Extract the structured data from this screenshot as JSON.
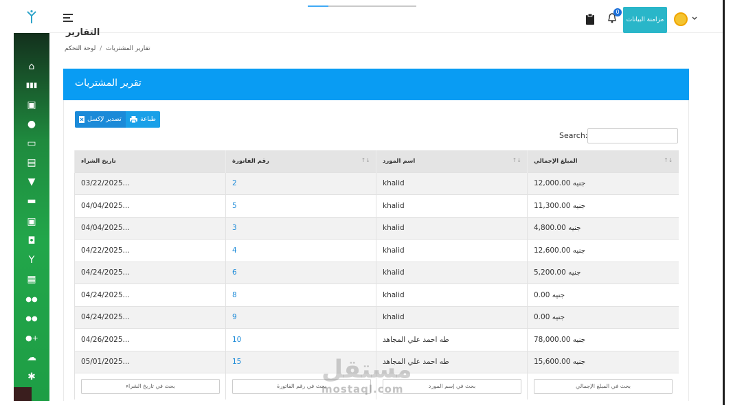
{
  "topbar": {
    "sync_button": "مزامنة البيانات",
    "notification_count": "0"
  },
  "page": {
    "title": "التقارير",
    "breadcrumb": [
      "تقارير المشتريات",
      "لوحة التحكم"
    ]
  },
  "card": {
    "title": "تقرير المشتريات",
    "export_label": "تصدير لإكسل",
    "print_label": "طباعة",
    "search_label": "Search:",
    "search_value": ""
  },
  "table": {
    "columns": [
      "تاريخ الشراء",
      "رقم الفاتورة",
      "اسم المورد",
      "المبلغ الإجمالي"
    ],
    "rows": [
      [
        "03/22/2025...",
        "2",
        "khalid",
        "12,000.00 جنيه"
      ],
      [
        "04/04/2025...",
        "5",
        "khalid",
        "11,300.00 جنيه"
      ],
      [
        "04/04/2025...",
        "3",
        "khalid",
        "4,800.00 جنيه"
      ],
      [
        "04/22/2025...",
        "4",
        "khalid",
        "12,600.00 جنيه"
      ],
      [
        "04/24/2025...",
        "6",
        "khalid",
        "5,200.00 جنيه"
      ],
      [
        "04/24/2025...",
        "8",
        "khalid",
        "0.00 جنيه"
      ],
      [
        "04/24/2025...",
        "9",
        "khalid",
        "0.00 جنيه"
      ],
      [
        "04/26/2025...",
        "10",
        "طه احمد علي المجاهد",
        "78,000.00 جنيه"
      ],
      [
        "05/01/2025...",
        "15",
        "طه احمد علي المجاهد",
        "15,600.00 جنيه"
      ]
    ],
    "filter_placeholders": [
      "بحث في تاريخ الشراء",
      "بحث في رقم الفاتورة",
      "بحث في إسم المورد",
      "بحث في المبلغ الإجمالي"
    ]
  },
  "watermark": {
    "text": "مستقل",
    "sub": "mostaql.com"
  },
  "sidebar": {
    "icons": [
      "home-icon",
      "chart-icon",
      "medkit-icon",
      "user-icon",
      "card-icon",
      "document-icon",
      "cart-icon",
      "truck-icon",
      "medkit-icon",
      "lock-icon",
      "figure-icon",
      "building-icon",
      "users-icon",
      "users-icon",
      "user-add-icon",
      "cloud-upload-icon",
      "gear-icon"
    ]
  },
  "colors": {
    "accent": "#099cf3",
    "sidebar_green": "#22a64a",
    "sync": "#29b6c9",
    "link": "#1b8ad8"
  }
}
